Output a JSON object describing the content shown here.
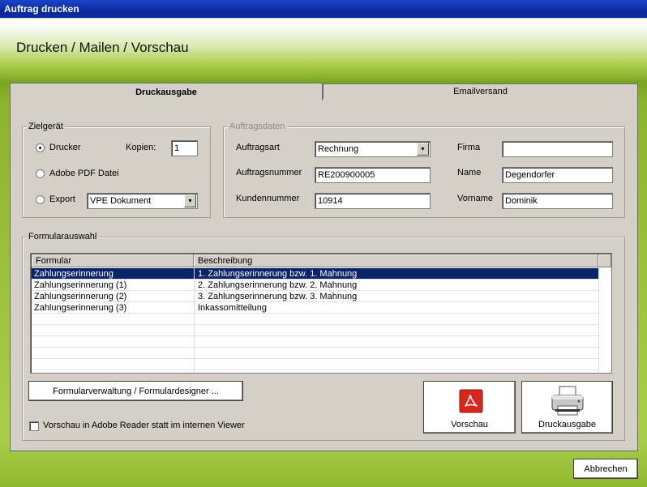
{
  "window": {
    "title": "Auftrag drucken"
  },
  "header": {
    "title": "Drucken / Mailen / Vorschau"
  },
  "tabs": [
    {
      "label": "Druckausgabe",
      "active": true
    },
    {
      "label": "Emailversand",
      "active": false
    }
  ],
  "zielgeraet": {
    "legend": "Zielgerät",
    "drucker_label": "Drucker",
    "kopien_label": "Kopien:",
    "kopien_value": "1",
    "pdf_label": "Adobe PDF Datei",
    "export_label": "Export",
    "export_value": "VPE Dokument",
    "selected": "Drucker"
  },
  "auftragsdaten": {
    "legend": "Auftragsdaten",
    "auftragsart_label": "Auftragsart",
    "auftragsart_value": "Rechnung",
    "auftragsnummer_label": "Auftragsnummer",
    "auftragsnummer_value": "RE200900005",
    "kundennummer_label": "Kundennummer",
    "kundennummer_value": "10914",
    "firma_label": "Firma",
    "firma_value": "",
    "name_label": "Name",
    "name_value": "Degendorfer",
    "vorname_label": "Vorname",
    "vorname_value": "Dominik"
  },
  "formularauswahl": {
    "legend": "Formularauswahl",
    "columns": [
      "Formular",
      "Beschreibung"
    ],
    "rows": [
      [
        "Zahlungserinnerung",
        "1. Zahlungserinnerung bzw. 1. Mahnung"
      ],
      [
        "Zahlungserinnerung (1)",
        "2. Zahlungserinnerung bzw. 2. Mahnung"
      ],
      [
        "Zahlungserinnerung (2)",
        "3. Zahlungserinnerung bzw. 3. Mahnung"
      ],
      [
        "Zahlungserinnerung (3)",
        "Inkassomitteilung"
      ]
    ],
    "selected_row": 0
  },
  "buttons": {
    "formular": "Formularverwaltung / Formulardesigner ...",
    "vorschau": "Vorschau",
    "druckausgabe": "Druckausgabe",
    "abbrechen": "Abbrechen"
  },
  "checkbox": {
    "label": "Vorschau in Adobe Reader statt im internen Viewer",
    "checked": false
  },
  "colors": {
    "accent_green": "#8bb52c",
    "title_blue": "#0a2a9e",
    "selection": "#0a246a"
  }
}
